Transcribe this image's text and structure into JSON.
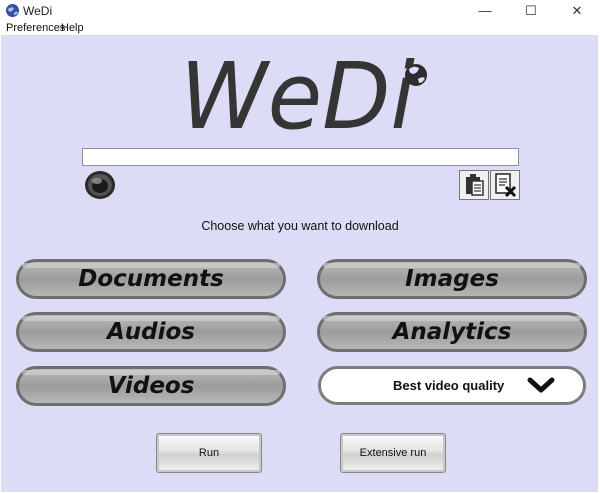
{
  "window": {
    "title": "WeDi",
    "controls": {
      "minimize": "—",
      "maximize": "☐",
      "close": "✕"
    }
  },
  "menu": {
    "items": [
      "Preferences",
      "Help"
    ]
  },
  "logo": {
    "text": "WeDi",
    "icon": "globe-icon"
  },
  "url_input": {
    "value": "",
    "placeholder": ""
  },
  "toolbar": {
    "paste_icon": "clipboard-icon",
    "clear_icon": "clear-x-icon"
  },
  "prompt": "Choose what you want to download",
  "categories": [
    "Documents",
    "Images",
    "Audios",
    "Analytics",
    "Videos"
  ],
  "quality_dropdown": {
    "selected": "Best video quality"
  },
  "actions": {
    "run": "Run",
    "extensive_run": "Extensive run"
  }
}
